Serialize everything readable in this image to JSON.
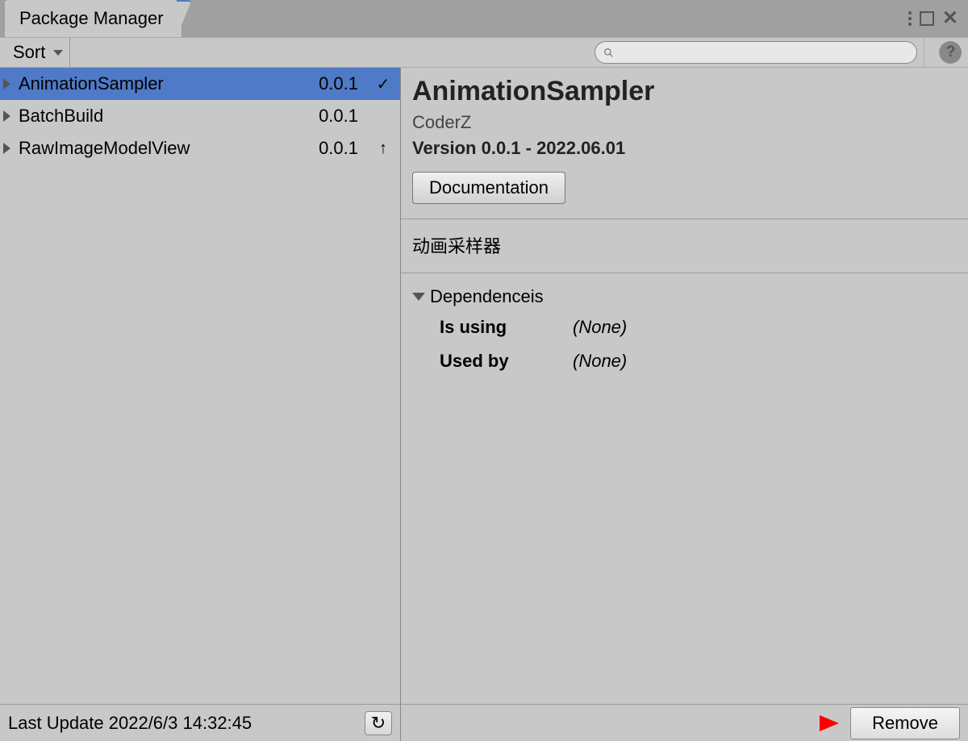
{
  "window": {
    "tab_title": "Package Manager"
  },
  "toolbar": {
    "sort_label": "Sort",
    "search_placeholder": ""
  },
  "packages": [
    {
      "name": "AnimationSampler",
      "version": "0.0.1",
      "status": "✓",
      "selected": true
    },
    {
      "name": "BatchBuild",
      "version": "0.0.1",
      "status": "",
      "selected": false
    },
    {
      "name": "RawImageModelView",
      "version": "0.0.1",
      "status": "↑",
      "selected": false
    }
  ],
  "left_footer": {
    "last_update": "Last Update 2022/6/3 14:32:45"
  },
  "detail": {
    "title": "AnimationSampler",
    "author": "CoderZ",
    "version_line": "Version 0.0.1 - 2022.06.01",
    "documentation_label": "Documentation",
    "description": "动画采样器",
    "dependencies_label": "Dependenceis",
    "is_using_label": "Is using",
    "is_using_value": "(None)",
    "used_by_label": "Used by",
    "used_by_value": "(None)"
  },
  "right_footer": {
    "remove_label": "Remove"
  }
}
